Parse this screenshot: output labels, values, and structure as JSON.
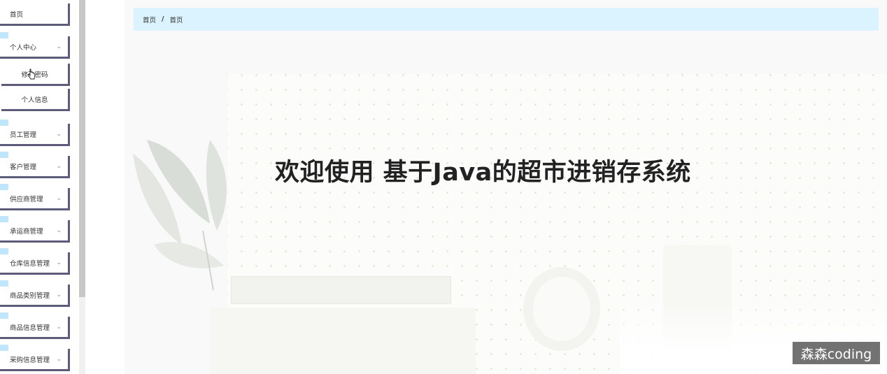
{
  "sidebar": {
    "items": [
      {
        "label": "首页",
        "has_arrow": false
      },
      {
        "label": "个人中心",
        "has_arrow": true
      },
      {
        "label": "修改密码",
        "has_arrow": false,
        "sub": true
      },
      {
        "label": "个人信息",
        "has_arrow": false,
        "sub": true
      },
      {
        "label": "员工管理",
        "has_arrow": true
      },
      {
        "label": "客户管理",
        "has_arrow": true
      },
      {
        "label": "供应商管理",
        "has_arrow": true
      },
      {
        "label": "承运商管理",
        "has_arrow": true
      },
      {
        "label": "仓库信息管理",
        "has_arrow": true
      },
      {
        "label": "商品类别管理",
        "has_arrow": true
      },
      {
        "label": "商品信息管理",
        "has_arrow": true
      },
      {
        "label": "采购信息管理",
        "has_arrow": true
      }
    ],
    "arrow_glyph": "⌄"
  },
  "breadcrumb": {
    "items": [
      "首页",
      "首页"
    ],
    "separator": "/"
  },
  "hero": {
    "title": "欢迎使用 基于Java的超市进销存系统"
  },
  "watermark": {
    "text": "森森coding"
  },
  "colors": {
    "breadcrumb_bg": "#dbf3fe",
    "menu_border": "#5d5b7a",
    "menu_marker": "#bfe6fb"
  }
}
